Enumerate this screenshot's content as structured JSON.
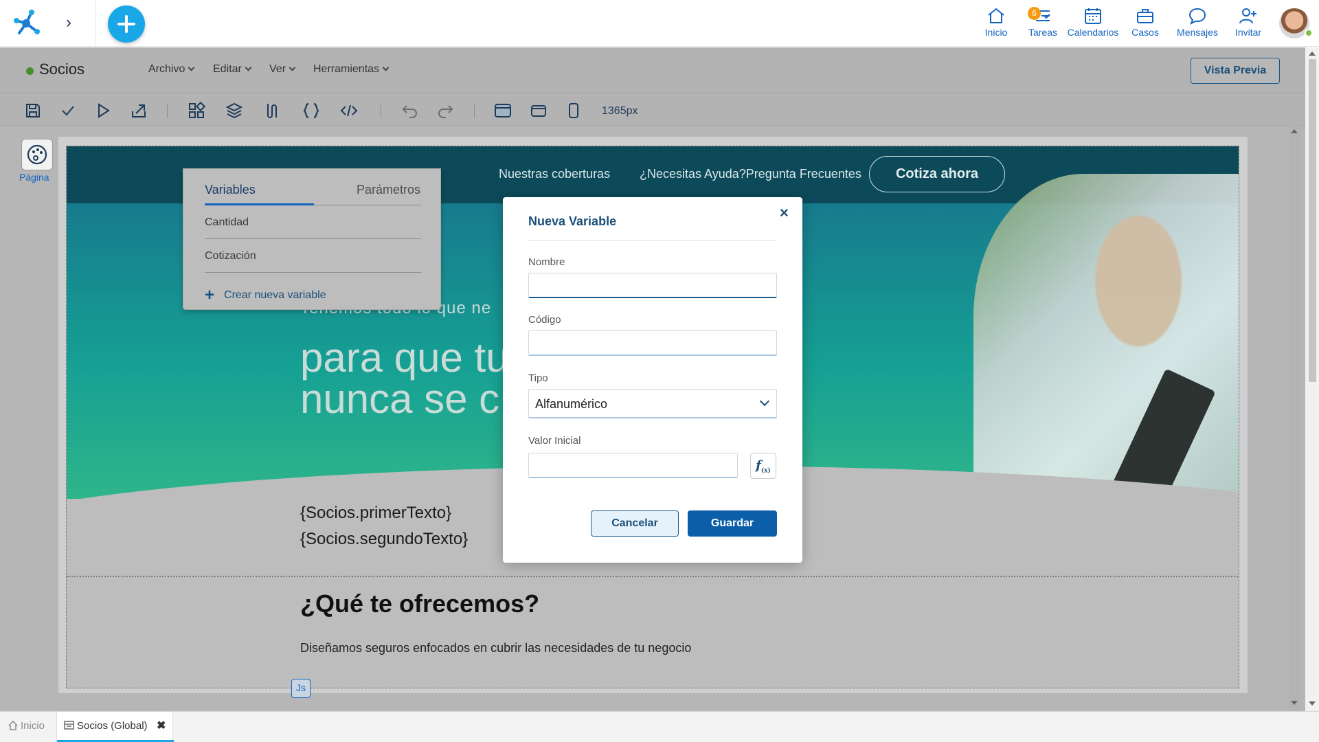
{
  "topnav": {
    "items": [
      {
        "label": "Inicio",
        "icon": "home-icon"
      },
      {
        "label": "Tareas",
        "icon": "tasks-icon",
        "badge": "6"
      },
      {
        "label": "Calendarios",
        "icon": "calendar-icon"
      },
      {
        "label": "Casos",
        "icon": "briefcase-icon"
      },
      {
        "label": "Mensajes",
        "icon": "chat-icon"
      },
      {
        "label": "Invitar",
        "icon": "invite-user-icon"
      }
    ],
    "accent": "#1aa7e8"
  },
  "titlebar": {
    "title": "Socios",
    "menus": [
      "Archivo",
      "Editar",
      "Ver",
      "Herramientas"
    ],
    "preview_label": "Vista Previa"
  },
  "toolbar": {
    "width_label": "1365px"
  },
  "sidebar": {
    "page_label": "Página"
  },
  "variables_panel": {
    "tabs": [
      "Variables",
      "Parámetros"
    ],
    "items": [
      "Cantidad",
      "Cotización"
    ],
    "create_label": "Crear nueva variable"
  },
  "site": {
    "nav_links": [
      "Nuestras coberturas",
      "¿Necesitas Ayuda?Pregunta Frecuentes"
    ],
    "cta_label": "Cotiza ahora",
    "hero_small": "Tenemos todo lo que ne",
    "hero_big_1": "para que tu",
    "hero_big_2": "nunca se c",
    "template_1": "{Socios.primerTexto}",
    "template_2": "{Socios.segundoTexto}",
    "section_title": "¿Qué te ofrecemos?",
    "section_sub": "Diseñamos seguros enfocados en cubrir las necesidades de tu negocio",
    "js_tag": "Js"
  },
  "modal": {
    "title": "Nueva Variable",
    "close": "×",
    "nombre_label": "Nombre",
    "nombre_value": "",
    "codigo_label": "Código",
    "codigo_value": "",
    "tipo_label": "Tipo",
    "tipo_value": "Alfanumérico",
    "valor_label": "Valor Inicial",
    "valor_value": "",
    "cancel_label": "Cancelar",
    "save_label": "Guardar"
  },
  "bottombar": {
    "tabs": [
      {
        "label": "Inicio",
        "icon": "home-icon"
      },
      {
        "label": "Socios (Global)",
        "icon": "form-icon",
        "close": "✖"
      }
    ]
  }
}
